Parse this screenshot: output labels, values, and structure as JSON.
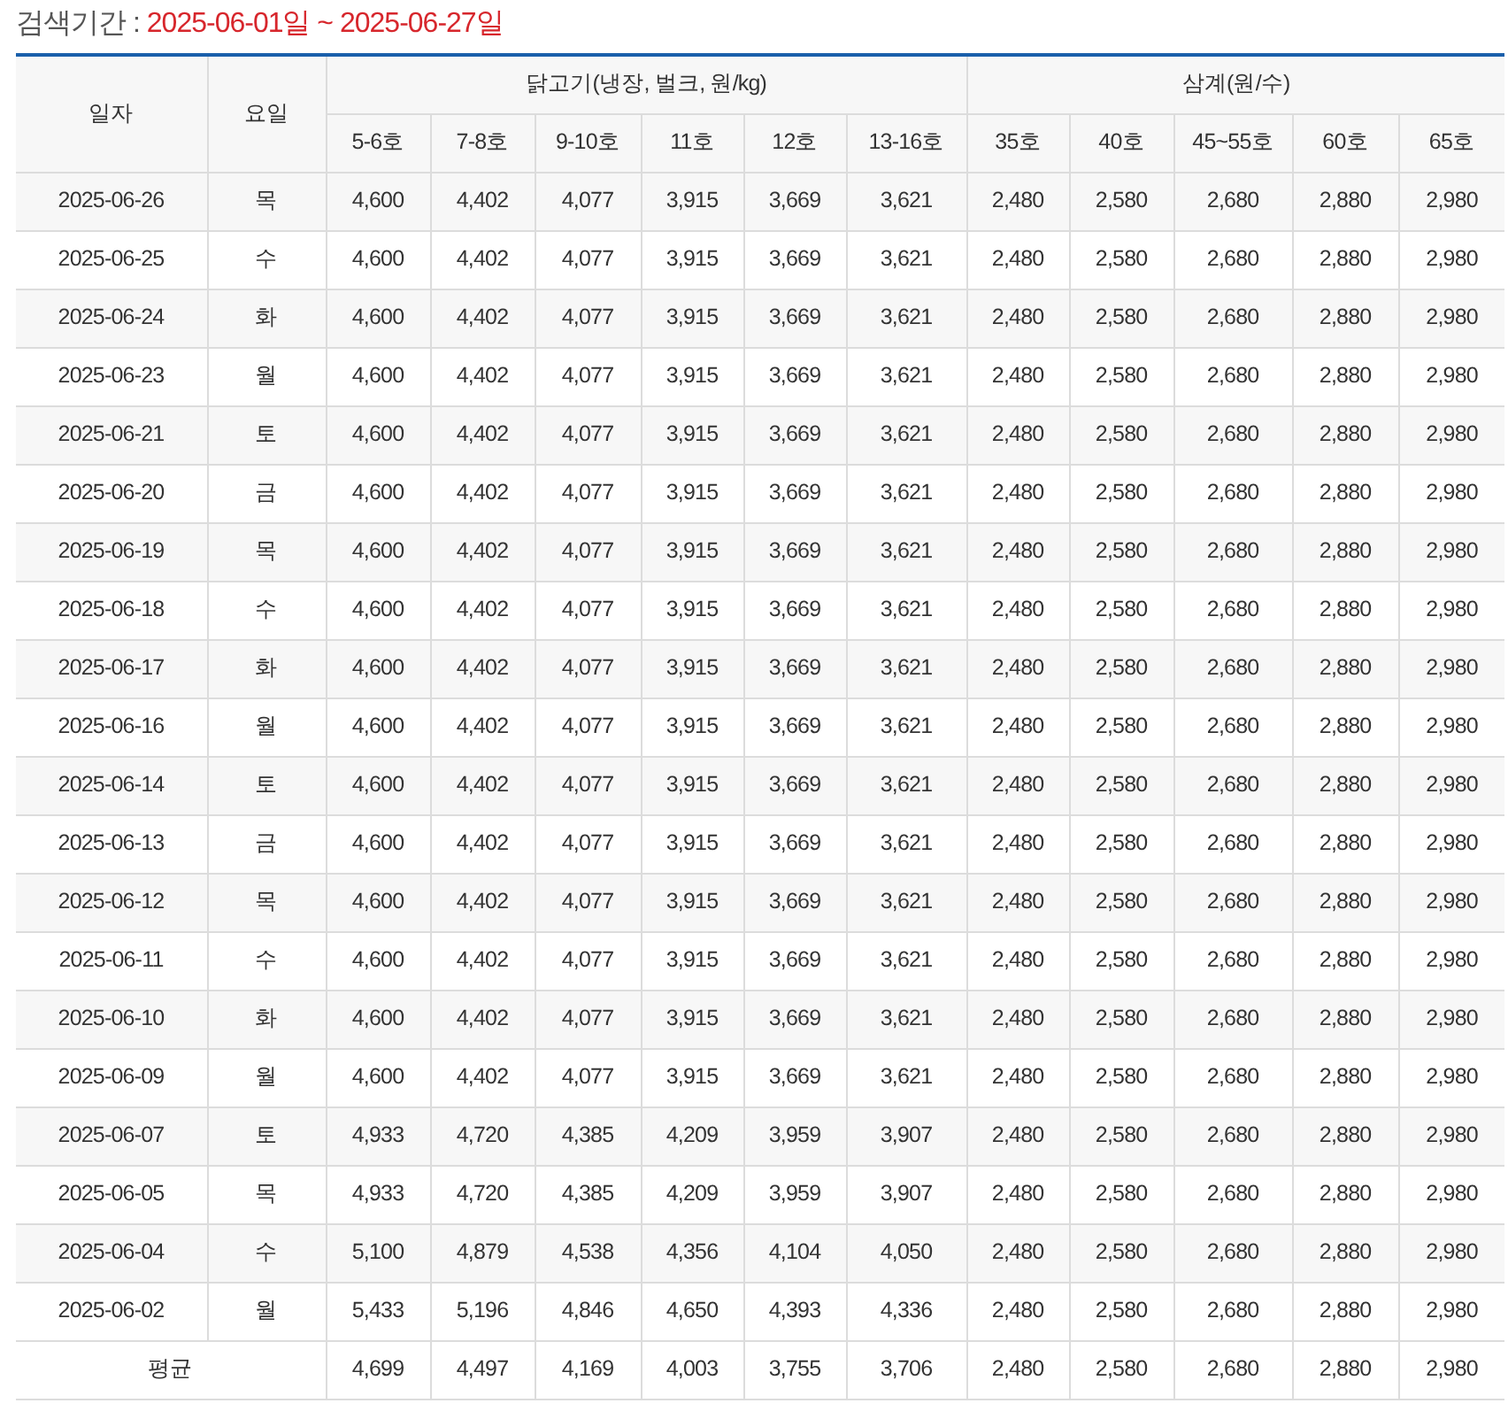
{
  "search_period": {
    "label": "검색기간 :",
    "value": "2025-06-01일 ~ 2025-06-27일"
  },
  "table": {
    "columns": [
      {
        "label": "일자"
      },
      {
        "label": "요일"
      }
    ],
    "groups": [
      {
        "label": "닭고기(냉장, 벌크, 원/kg)",
        "columns": [
          "5-6호",
          "7-8호",
          "9-10호",
          "11호",
          "12호",
          "13-16호"
        ]
      },
      {
        "label": "삼계(원/수)",
        "columns": [
          "35호",
          "40호",
          "45~55호",
          "60호",
          "65호"
        ]
      }
    ],
    "rows": [
      {
        "date": "2025-06-26",
        "day": "목",
        "values": [
          "4,600",
          "4,402",
          "4,077",
          "3,915",
          "3,669",
          "3,621",
          "2,480",
          "2,580",
          "2,680",
          "2,880",
          "2,980"
        ]
      },
      {
        "date": "2025-06-25",
        "day": "수",
        "values": [
          "4,600",
          "4,402",
          "4,077",
          "3,915",
          "3,669",
          "3,621",
          "2,480",
          "2,580",
          "2,680",
          "2,880",
          "2,980"
        ]
      },
      {
        "date": "2025-06-24",
        "day": "화",
        "values": [
          "4,600",
          "4,402",
          "4,077",
          "3,915",
          "3,669",
          "3,621",
          "2,480",
          "2,580",
          "2,680",
          "2,880",
          "2,980"
        ]
      },
      {
        "date": "2025-06-23",
        "day": "월",
        "values": [
          "4,600",
          "4,402",
          "4,077",
          "3,915",
          "3,669",
          "3,621",
          "2,480",
          "2,580",
          "2,680",
          "2,880",
          "2,980"
        ]
      },
      {
        "date": "2025-06-21",
        "day": "토",
        "values": [
          "4,600",
          "4,402",
          "4,077",
          "3,915",
          "3,669",
          "3,621",
          "2,480",
          "2,580",
          "2,680",
          "2,880",
          "2,980"
        ]
      },
      {
        "date": "2025-06-20",
        "day": "금",
        "values": [
          "4,600",
          "4,402",
          "4,077",
          "3,915",
          "3,669",
          "3,621",
          "2,480",
          "2,580",
          "2,680",
          "2,880",
          "2,980"
        ]
      },
      {
        "date": "2025-06-19",
        "day": "목",
        "values": [
          "4,600",
          "4,402",
          "4,077",
          "3,915",
          "3,669",
          "3,621",
          "2,480",
          "2,580",
          "2,680",
          "2,880",
          "2,980"
        ]
      },
      {
        "date": "2025-06-18",
        "day": "수",
        "values": [
          "4,600",
          "4,402",
          "4,077",
          "3,915",
          "3,669",
          "3,621",
          "2,480",
          "2,580",
          "2,680",
          "2,880",
          "2,980"
        ]
      },
      {
        "date": "2025-06-17",
        "day": "화",
        "values": [
          "4,600",
          "4,402",
          "4,077",
          "3,915",
          "3,669",
          "3,621",
          "2,480",
          "2,580",
          "2,680",
          "2,880",
          "2,980"
        ]
      },
      {
        "date": "2025-06-16",
        "day": "월",
        "values": [
          "4,600",
          "4,402",
          "4,077",
          "3,915",
          "3,669",
          "3,621",
          "2,480",
          "2,580",
          "2,680",
          "2,880",
          "2,980"
        ]
      },
      {
        "date": "2025-06-14",
        "day": "토",
        "values": [
          "4,600",
          "4,402",
          "4,077",
          "3,915",
          "3,669",
          "3,621",
          "2,480",
          "2,580",
          "2,680",
          "2,880",
          "2,980"
        ]
      },
      {
        "date": "2025-06-13",
        "day": "금",
        "values": [
          "4,600",
          "4,402",
          "4,077",
          "3,915",
          "3,669",
          "3,621",
          "2,480",
          "2,580",
          "2,680",
          "2,880",
          "2,980"
        ]
      },
      {
        "date": "2025-06-12",
        "day": "목",
        "values": [
          "4,600",
          "4,402",
          "4,077",
          "3,915",
          "3,669",
          "3,621",
          "2,480",
          "2,580",
          "2,680",
          "2,880",
          "2,980"
        ]
      },
      {
        "date": "2025-06-11",
        "day": "수",
        "values": [
          "4,600",
          "4,402",
          "4,077",
          "3,915",
          "3,669",
          "3,621",
          "2,480",
          "2,580",
          "2,680",
          "2,880",
          "2,980"
        ]
      },
      {
        "date": "2025-06-10",
        "day": "화",
        "values": [
          "4,600",
          "4,402",
          "4,077",
          "3,915",
          "3,669",
          "3,621",
          "2,480",
          "2,580",
          "2,680",
          "2,880",
          "2,980"
        ]
      },
      {
        "date": "2025-06-09",
        "day": "월",
        "values": [
          "4,600",
          "4,402",
          "4,077",
          "3,915",
          "3,669",
          "3,621",
          "2,480",
          "2,580",
          "2,680",
          "2,880",
          "2,980"
        ]
      },
      {
        "date": "2025-06-07",
        "day": "토",
        "values": [
          "4,933",
          "4,720",
          "4,385",
          "4,209",
          "3,959",
          "3,907",
          "2,480",
          "2,580",
          "2,680",
          "2,880",
          "2,980"
        ]
      },
      {
        "date": "2025-06-05",
        "day": "목",
        "values": [
          "4,933",
          "4,720",
          "4,385",
          "4,209",
          "3,959",
          "3,907",
          "2,480",
          "2,580",
          "2,680",
          "2,880",
          "2,980"
        ]
      },
      {
        "date": "2025-06-04",
        "day": "수",
        "values": [
          "5,100",
          "4,879",
          "4,538",
          "4,356",
          "4,104",
          "4,050",
          "2,480",
          "2,580",
          "2,680",
          "2,880",
          "2,980"
        ]
      },
      {
        "date": "2025-06-02",
        "day": "월",
        "values": [
          "5,433",
          "5,196",
          "4,846",
          "4,650",
          "4,393",
          "4,336",
          "2,480",
          "2,580",
          "2,680",
          "2,880",
          "2,980"
        ]
      }
    ],
    "average": {
      "label": "평균",
      "values": [
        "4,699",
        "4,497",
        "4,169",
        "4,003",
        "3,755",
        "3,706",
        "2,480",
        "2,580",
        "2,680",
        "2,880",
        "2,980"
      ]
    }
  }
}
